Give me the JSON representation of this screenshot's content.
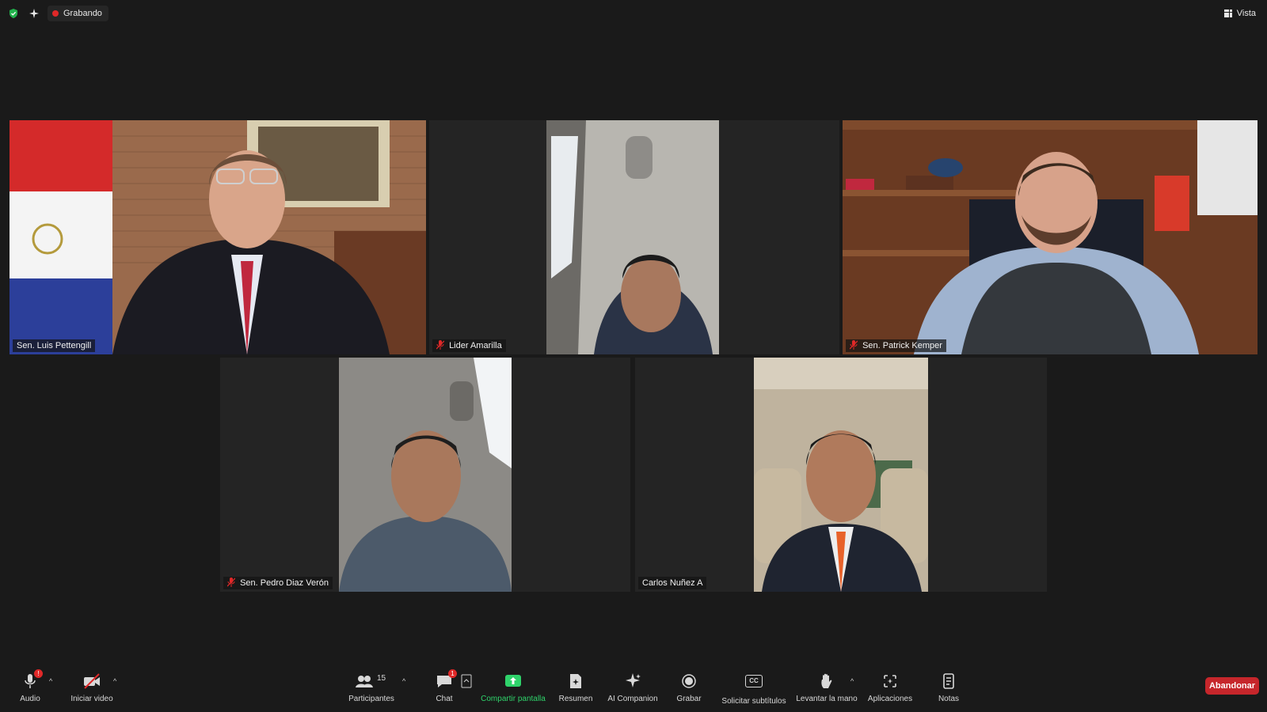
{
  "topbar": {
    "recording_label": "Grabando",
    "view_label": "Vista"
  },
  "participants": {
    "p1": {
      "name": "Sen. Luis Pettengill"
    },
    "p2": {
      "name": "Lider Amarilla"
    },
    "p3": {
      "name": "Sen. Patrick Kemper"
    },
    "p4": {
      "name": "Sen. Pedro Diaz Verón"
    },
    "p5": {
      "name": "Carlos Nuñez A"
    }
  },
  "toolbar": {
    "audio_label": "Audio",
    "audio_badge": "!",
    "video_label": "Iniciar video",
    "participants_label": "Participantes",
    "participants_count": "15",
    "chat_label": "Chat",
    "chat_badge": "1",
    "share_label": "Compartir pantalla",
    "summary_label": "Resumen",
    "ai_label": "AI Companion",
    "record_label": "Grabar",
    "captions_label": "Solicitar subtítulos",
    "captions_icon_text": "CC",
    "hand_label": "Levantar la mano",
    "apps_label": "Aplicaciones",
    "notes_label": "Notas",
    "leave_label": "Abandonar"
  },
  "colors": {
    "background": "#1a1a1a",
    "active_speaker_border": "#c9e34a",
    "recording_dot": "#e02828",
    "leave_button": "#c6262b",
    "share_accent": "#2fd36b"
  }
}
